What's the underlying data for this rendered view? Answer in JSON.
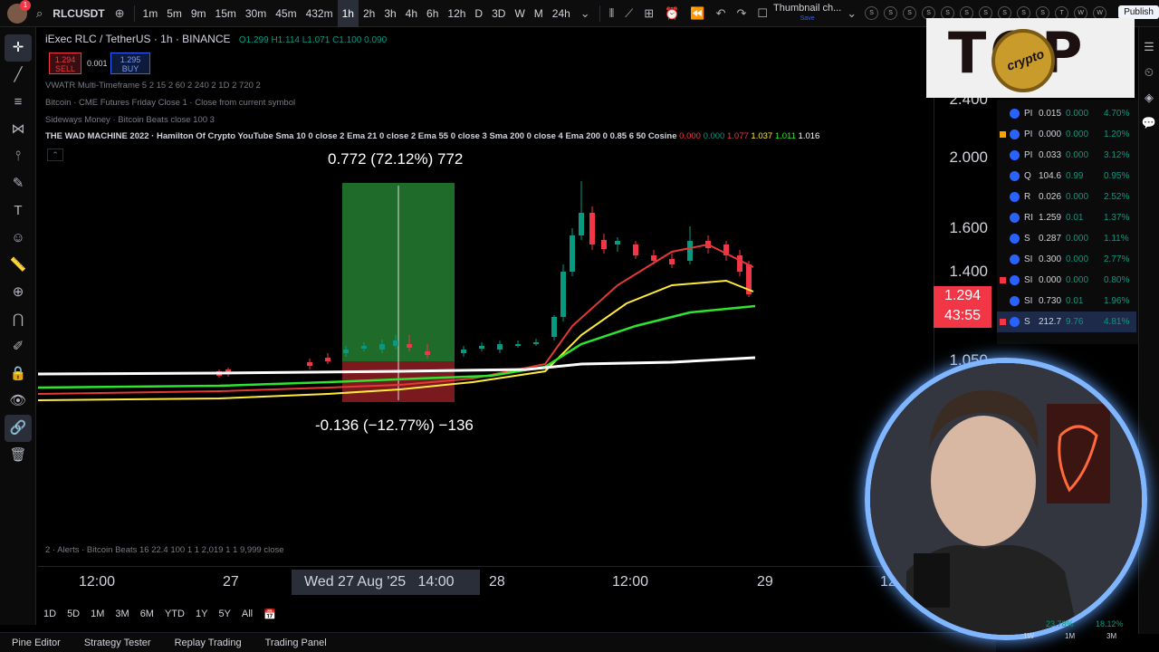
{
  "topbar": {
    "badge": "1",
    "symbol": "RLCUSDT",
    "timeframes": [
      "1m",
      "5m",
      "9m",
      "15m",
      "30m",
      "45m",
      "432m",
      "1h",
      "2h",
      "3h",
      "4h",
      "6h",
      "12h",
      "D",
      "3D",
      "W",
      "M",
      "24h"
    ],
    "active_timeframe": "1h",
    "layout_name": "Thumbnail ch...",
    "layout_status": "Save",
    "publish": "Publish",
    "top_circles": [
      "S",
      "S",
      "S",
      "S",
      "S",
      "S",
      "S",
      "S",
      "S",
      "S",
      "T",
      "W",
      "W"
    ]
  },
  "legend": {
    "title": "iExec RLC / TetherUS · 1h · BINANCE",
    "ohlc": "O1.299 H1.114 L1.071 C1.100 0.090",
    "sell_price": "1.294",
    "sell_label": "SELL",
    "spread": "0.001",
    "buy_price": "1.295",
    "buy_label": "BUY",
    "indicators": [
      "VWATR Multi-Timeframe 5 2 15 2 60 2 240 2 1D 2 720 2",
      "Bitcoin · CME Futures Friday Close 1 · Close from current symbol",
      "Sideways Money · Bitcoin Beats close 100 3"
    ],
    "wad": "THE WAD MACHINE 2022 · Hamilton Of Crypto YouTube Sma 10 0 close 2 Ema 21 0 close 2 Ema 55 0 close 3 Sma 200 0 close 4 Ema 200 0 0.85 6 50 Cosine",
    "wad_values": [
      "0.000",
      "0.000",
      "1.077",
      "1.037",
      "1.011",
      "1.016"
    ],
    "alerts": "2 · Alerts · Bitcoin Beats 16 22.4 100 1 1 2,019 1 1 9,999 close"
  },
  "measure": {
    "top": "0.772 (72.12%) 772",
    "bottom": "-0.136 (−12.77%) −136"
  },
  "price_axis": {
    "labels": [
      "2.400",
      "2.000",
      "1.600",
      "1.400",
      "1.050"
    ],
    "last_price": "1.294",
    "countdown": "43:55"
  },
  "time_axis": {
    "labels": [
      "12:00",
      "27",
      "28",
      "12:00",
      "29",
      "12:00"
    ],
    "crosshair": "Wed 27 Aug '25",
    "crosshair_time": "14:00"
  },
  "ranges": [
    "1D",
    "5D",
    "1M",
    "3M",
    "6M",
    "YTD",
    "1Y",
    "5Y",
    "All"
  ],
  "bottom_tabs": [
    "Pine Editor",
    "Strategy Tester",
    "Replay Trading",
    "Trading Panel"
  ],
  "watchlist": [
    {
      "s": "PI",
      "p": "0.015",
      "c": "0.000",
      "pc": "4.70%"
    },
    {
      "s": "PI",
      "p": "0.000",
      "c": "0.000",
      "pc": "1.20%"
    },
    {
      "s": "PI",
      "p": "0.033",
      "c": "0.000",
      "pc": "3.12%"
    },
    {
      "s": "Q",
      "p": "104.6",
      "c": "0.99",
      "pc": "0.95%"
    },
    {
      "s": "R",
      "p": "0.026",
      "c": "0.000",
      "pc": "2.52%"
    },
    {
      "s": "RI",
      "p": "1.259",
      "c": "0.01",
      "pc": "1.37%"
    },
    {
      "s": "S",
      "p": "0.287",
      "c": "0.000",
      "pc": "1.11%"
    },
    {
      "s": "SI",
      "p": "0.300",
      "c": "0.000",
      "pc": "2.77%"
    },
    {
      "s": "SI",
      "p": "0.000",
      "c": "0.000",
      "pc": "0.80%"
    },
    {
      "s": "SI",
      "p": "0.730",
      "c": "0.01",
      "pc": "1.96%"
    },
    {
      "s": "S",
      "p": "212.7",
      "c": "9.76",
      "pc": "4.81%"
    }
  ],
  "webcam_overlay": {
    "pct1": "23.78%",
    "pct2": "18.12%",
    "labels": [
      "1W",
      "1M",
      "3M"
    ]
  },
  "logo": {
    "text": "TOP",
    "coin": "crypto"
  },
  "colors": {
    "up": "#089981",
    "down": "#f23645",
    "accent": "#2962ff",
    "green_box": "#1f6b2a",
    "red_box": "#7a1a1f"
  }
}
